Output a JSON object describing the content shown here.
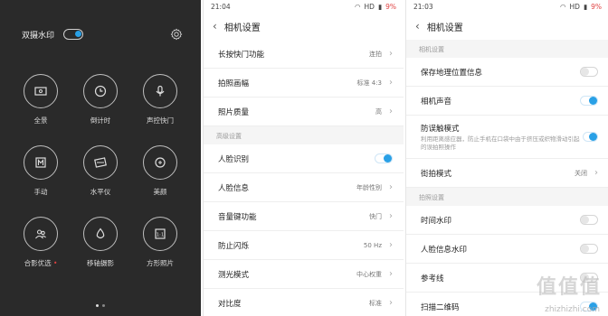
{
  "panel1": {
    "title": "双摄水印",
    "modes": [
      {
        "label": "全景",
        "icon": "panorama-icon"
      },
      {
        "label": "倒计时",
        "icon": "timer-icon"
      },
      {
        "label": "声控快门",
        "icon": "microphone-icon"
      },
      {
        "label": "手动",
        "icon": "manual-icon"
      },
      {
        "label": "水平仪",
        "icon": "level-icon"
      },
      {
        "label": "美颜",
        "icon": "beauty-icon"
      },
      {
        "label": "合影优选",
        "icon": "group-photo-icon"
      },
      {
        "label": "移轴摄影",
        "icon": "tilt-shift-icon"
      },
      {
        "label": "方形照片",
        "icon": "square-photo-icon"
      }
    ]
  },
  "panel2": {
    "time": "21:04",
    "battery": "9%",
    "network": "HD",
    "title": "相机设置",
    "rows_top": [
      {
        "label": "长按快门功能",
        "value": "连拍"
      },
      {
        "label": "拍照画幅",
        "value": "标准 4:3"
      },
      {
        "label": "照片质量",
        "value": "高"
      }
    ],
    "section": "高级设置",
    "rows_bottom": [
      {
        "label": "人脸识别",
        "toggle": "on"
      },
      {
        "label": "人脸信息",
        "value": "年龄性别"
      },
      {
        "label": "音量键功能",
        "value": "快门"
      },
      {
        "label": "防止闪烁",
        "value": "50 Hz"
      },
      {
        "label": "测光模式",
        "value": "中心权重"
      },
      {
        "label": "对比度",
        "value": "标准"
      }
    ]
  },
  "panel3": {
    "time": "21:03",
    "battery": "9%",
    "network": "HD",
    "title": "相机设置",
    "section1": "相机设置",
    "rows1": [
      {
        "label": "保存地理位置信息",
        "toggle": "off"
      },
      {
        "label": "相机声音",
        "toggle": "on"
      },
      {
        "label": "防误触模式",
        "sub": "利用距离感应器，防止手机在口袋中由于挤压或织物滑动引起的误拍照操作",
        "toggle": "on"
      },
      {
        "label": "街拍模式",
        "value": "关闭"
      }
    ],
    "section2": "拍照设置",
    "rows2": [
      {
        "label": "时间水印",
        "toggle": "off"
      },
      {
        "label": "人脸信息水印",
        "toggle": "off"
      },
      {
        "label": "参考线",
        "toggle": "off"
      },
      {
        "label": "扫描二维码",
        "toggle": "on"
      }
    ],
    "watermark": "值值值",
    "watermark_url": "zhizhizhi.com"
  },
  "colors": {
    "accent": "#29a0e6",
    "dark_bg": "#2a2a2a"
  }
}
